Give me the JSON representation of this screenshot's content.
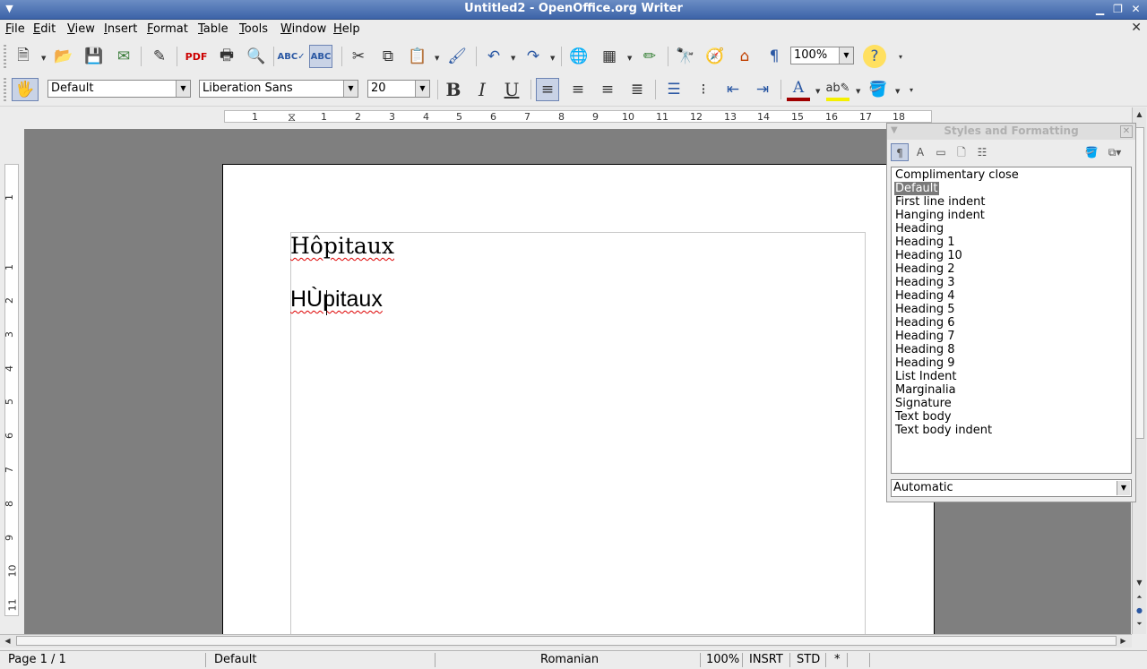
{
  "window": {
    "title": "Untitled2 - OpenOffice.org Writer"
  },
  "menu": [
    "File",
    "Edit",
    "View",
    "Insert",
    "Format",
    "Table",
    "Tools",
    "Window",
    "Help"
  ],
  "toolbar_standard": {
    "zoom": "100%"
  },
  "toolbar_formatting": {
    "paragraph_style": "Default",
    "font_name": "Liberation Sans",
    "font_size": "20",
    "bold": "B",
    "italic": "I",
    "underline": "U"
  },
  "ruler": {
    "horizontal_numbers": [
      "1",
      "1",
      "2",
      "3",
      "4",
      "5",
      "6",
      "7",
      "8",
      "9",
      "10",
      "11",
      "12",
      "13",
      "14",
      "15",
      "16",
      "17",
      "18"
    ],
    "vertical_numbers": [
      "1",
      "1",
      "2",
      "3",
      "4",
      "5",
      "6",
      "7",
      "8",
      "9",
      "10",
      "11"
    ]
  },
  "document": {
    "lines": [
      "Hôpitaux",
      "HÙpitaux"
    ]
  },
  "styles_panel": {
    "title": "Styles and Formatting",
    "items": [
      "Complimentary close",
      "Default",
      "First line indent",
      "Hanging indent",
      "Heading",
      "Heading 1",
      "Heading 10",
      "Heading 2",
      "Heading 3",
      "Heading 4",
      "Heading 5",
      "Heading 6",
      "Heading 7",
      "Heading 8",
      "Heading 9",
      "List Indent",
      "Marginalia",
      "Signature",
      "Text body",
      "Text body indent"
    ],
    "selected": "Default",
    "filter": "Automatic"
  },
  "status": {
    "page": "Page 1 / 1",
    "style": "Default",
    "language": "Romanian",
    "zoom": "100%",
    "insert_mode": "INSRT",
    "selection_mode": "STD",
    "modified": "*"
  }
}
